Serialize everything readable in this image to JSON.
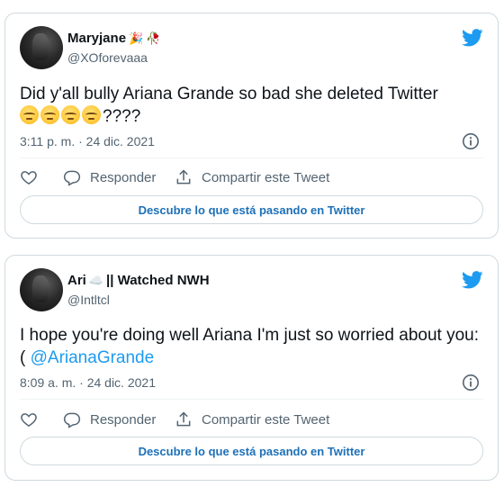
{
  "tweets": [
    {
      "name": "Maryjane",
      "name_emojis": [
        "🎉",
        "🥀"
      ],
      "handle": "@XOforevaaa",
      "text": "Did y'all bully Ariana Grande so bad she deleted Twitter",
      "text_emojis": [
        "😔",
        "😔",
        "😔",
        "😔"
      ],
      "text_suffix": "????",
      "timestamp": "3:11 p. m. · 24 dic. 2021",
      "reply_label": "Responder",
      "share_label": "Compartir este Tweet",
      "discover_label": "Descubre lo que está pasando en Twitter"
    },
    {
      "name": "Ari",
      "name_emojis": [
        "☁️"
      ],
      "name_suffix": "|| Watched NWH",
      "handle": "@Intltcl",
      "text": "I hope you're doing well Ariana I'm just so worried about you:(",
      "mention": "@ArianaGrande",
      "timestamp": "8:09 a. m. · 24 dic. 2021",
      "reply_label": "Responder",
      "share_label": "Compartir este Tweet",
      "discover_label": "Descubre lo que está pasando en Twitter"
    }
  ],
  "icons": {
    "brand": "twitter-bird-icon",
    "info": "info-icon",
    "like": "heart-icon",
    "reply": "speech-bubble-icon",
    "share": "share-arrow-icon"
  },
  "colors": {
    "brand_blue": "#1d9bf0",
    "text": "#0f1419",
    "muted": "#536471",
    "border": "#cfd9de",
    "link": "#1d70b8"
  }
}
